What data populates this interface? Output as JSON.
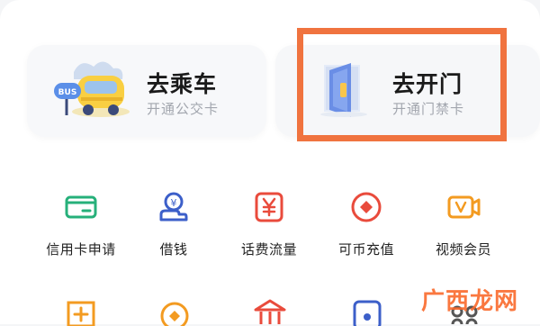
{
  "cards": [
    {
      "title": "去乘车",
      "subtitle": "开通公交卡",
      "icon": "bus-icon"
    },
    {
      "title": "去开门",
      "subtitle": "开通门禁卡",
      "icon": "door-icon"
    }
  ],
  "bus_sign": "BUS",
  "services": [
    {
      "label": "信用卡申请",
      "icon": "credit-card-icon"
    },
    {
      "label": "借钱",
      "icon": "coin-hand-icon"
    },
    {
      "label": "话费流量",
      "icon": "yen-icon"
    },
    {
      "label": "可币充值",
      "icon": "diamond-coin-icon"
    },
    {
      "label": "视频会员",
      "icon": "vip-video-icon"
    }
  ],
  "watermark": "广西龙网",
  "colors": {
    "highlight": "#f0733f",
    "green": "#26b07a",
    "blue": "#3c5fc9",
    "red": "#e94b3c",
    "orange": "#f39b21"
  }
}
